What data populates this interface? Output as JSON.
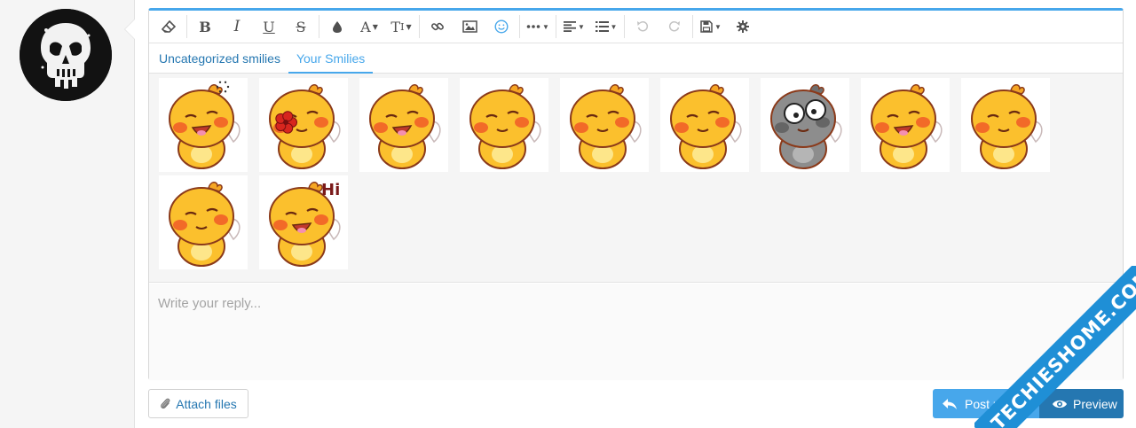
{
  "toolbar": {
    "buttons": [
      {
        "name": "remove-format-button",
        "icon": "eraser-icon"
      },
      {
        "name": "bold-button",
        "glyph": "B"
      },
      {
        "name": "italic-button",
        "glyph": "I"
      },
      {
        "name": "underline-button",
        "glyph": "U"
      },
      {
        "name": "strikethrough-button",
        "glyph": "S"
      },
      {
        "name": "text-color-button",
        "icon": "droplet-icon"
      },
      {
        "name": "font-family-button",
        "glyph": "A"
      },
      {
        "name": "font-size-button",
        "glyph": "T"
      },
      {
        "name": "link-button",
        "icon": "link-icon"
      },
      {
        "name": "image-button",
        "icon": "image-icon"
      },
      {
        "name": "smilies-button",
        "icon": "smile-icon",
        "active_color": "#47a7eb"
      },
      {
        "name": "more-button",
        "icon": "ellipsis-icon"
      },
      {
        "name": "align-button",
        "icon": "align-left-icon"
      },
      {
        "name": "list-button",
        "icon": "list-icon"
      },
      {
        "name": "undo-button",
        "icon": "undo-icon"
      },
      {
        "name": "redo-button",
        "icon": "redo-icon"
      },
      {
        "name": "drafts-button",
        "icon": "save-icon"
      },
      {
        "name": "settings-button",
        "icon": "gear-icon"
      }
    ]
  },
  "smilie_tabs": {
    "uncategorized": "Uncategorized smilies",
    "yours": "Your Smilies",
    "selected": "yours"
  },
  "smilies_count": 11,
  "reply": {
    "placeholder": "Write your reply..."
  },
  "actions": {
    "attach_label": "Attach files",
    "post_label": "Post re",
    "preview_label": "Preview"
  },
  "watermark": {
    "text": "TECHIESHOME.COM"
  },
  "colors": {
    "accent": "#47a7eb",
    "link": "#2577b1",
    "primary_dark": "#2577b1"
  }
}
